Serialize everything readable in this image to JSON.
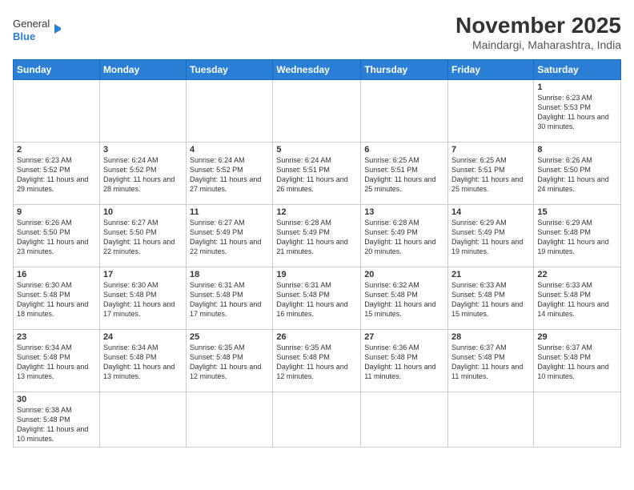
{
  "header": {
    "logo_general": "General",
    "logo_blue": "Blue",
    "month_title": "November 2025",
    "location": "Maindargi, Maharashtra, India"
  },
  "weekdays": [
    "Sunday",
    "Monday",
    "Tuesday",
    "Wednesday",
    "Thursday",
    "Friday",
    "Saturday"
  ],
  "days": {
    "d1": {
      "num": "1",
      "sunrise": "6:23 AM",
      "sunset": "5:53 PM",
      "daylight": "11 hours and 30 minutes."
    },
    "d2": {
      "num": "2",
      "sunrise": "6:23 AM",
      "sunset": "5:52 PM",
      "daylight": "11 hours and 29 minutes."
    },
    "d3": {
      "num": "3",
      "sunrise": "6:24 AM",
      "sunset": "5:52 PM",
      "daylight": "11 hours and 28 minutes."
    },
    "d4": {
      "num": "4",
      "sunrise": "6:24 AM",
      "sunset": "5:52 PM",
      "daylight": "11 hours and 27 minutes."
    },
    "d5": {
      "num": "5",
      "sunrise": "6:24 AM",
      "sunset": "5:51 PM",
      "daylight": "11 hours and 26 minutes."
    },
    "d6": {
      "num": "6",
      "sunrise": "6:25 AM",
      "sunset": "5:51 PM",
      "daylight": "11 hours and 25 minutes."
    },
    "d7": {
      "num": "7",
      "sunrise": "6:25 AM",
      "sunset": "5:51 PM",
      "daylight": "11 hours and 25 minutes."
    },
    "d8": {
      "num": "8",
      "sunrise": "6:26 AM",
      "sunset": "5:50 PM",
      "daylight": "11 hours and 24 minutes."
    },
    "d9": {
      "num": "9",
      "sunrise": "6:26 AM",
      "sunset": "5:50 PM",
      "daylight": "11 hours and 23 minutes."
    },
    "d10": {
      "num": "10",
      "sunrise": "6:27 AM",
      "sunset": "5:50 PM",
      "daylight": "11 hours and 22 minutes."
    },
    "d11": {
      "num": "11",
      "sunrise": "6:27 AM",
      "sunset": "5:49 PM",
      "daylight": "11 hours and 22 minutes."
    },
    "d12": {
      "num": "12",
      "sunrise": "6:28 AM",
      "sunset": "5:49 PM",
      "daylight": "11 hours and 21 minutes."
    },
    "d13": {
      "num": "13",
      "sunrise": "6:28 AM",
      "sunset": "5:49 PM",
      "daylight": "11 hours and 20 minutes."
    },
    "d14": {
      "num": "14",
      "sunrise": "6:29 AM",
      "sunset": "5:49 PM",
      "daylight": "11 hours and 19 minutes."
    },
    "d15": {
      "num": "15",
      "sunrise": "6:29 AM",
      "sunset": "5:48 PM",
      "daylight": "11 hours and 19 minutes."
    },
    "d16": {
      "num": "16",
      "sunrise": "6:30 AM",
      "sunset": "5:48 PM",
      "daylight": "11 hours and 18 minutes."
    },
    "d17": {
      "num": "17",
      "sunrise": "6:30 AM",
      "sunset": "5:48 PM",
      "daylight": "11 hours and 17 minutes."
    },
    "d18": {
      "num": "18",
      "sunrise": "6:31 AM",
      "sunset": "5:48 PM",
      "daylight": "11 hours and 17 minutes."
    },
    "d19": {
      "num": "19",
      "sunrise": "6:31 AM",
      "sunset": "5:48 PM",
      "daylight": "11 hours and 16 minutes."
    },
    "d20": {
      "num": "20",
      "sunrise": "6:32 AM",
      "sunset": "5:48 PM",
      "daylight": "11 hours and 15 minutes."
    },
    "d21": {
      "num": "21",
      "sunrise": "6:33 AM",
      "sunset": "5:48 PM",
      "daylight": "11 hours and 15 minutes."
    },
    "d22": {
      "num": "22",
      "sunrise": "6:33 AM",
      "sunset": "5:48 PM",
      "daylight": "11 hours and 14 minutes."
    },
    "d23": {
      "num": "23",
      "sunrise": "6:34 AM",
      "sunset": "5:48 PM",
      "daylight": "11 hours and 13 minutes."
    },
    "d24": {
      "num": "24",
      "sunrise": "6:34 AM",
      "sunset": "5:48 PM",
      "daylight": "11 hours and 13 minutes."
    },
    "d25": {
      "num": "25",
      "sunrise": "6:35 AM",
      "sunset": "5:48 PM",
      "daylight": "11 hours and 12 minutes."
    },
    "d26": {
      "num": "26",
      "sunrise": "6:35 AM",
      "sunset": "5:48 PM",
      "daylight": "11 hours and 12 minutes."
    },
    "d27": {
      "num": "27",
      "sunrise": "6:36 AM",
      "sunset": "5:48 PM",
      "daylight": "11 hours and 11 minutes."
    },
    "d28": {
      "num": "28",
      "sunrise": "6:37 AM",
      "sunset": "5:48 PM",
      "daylight": "11 hours and 11 minutes."
    },
    "d29": {
      "num": "29",
      "sunrise": "6:37 AM",
      "sunset": "5:48 PM",
      "daylight": "11 hours and 10 minutes."
    },
    "d30": {
      "num": "30",
      "sunrise": "6:38 AM",
      "sunset": "5:48 PM",
      "daylight": "11 hours and 10 minutes."
    }
  },
  "labels": {
    "sunrise": "Sunrise:",
    "sunset": "Sunset:",
    "daylight": "Daylight:"
  }
}
